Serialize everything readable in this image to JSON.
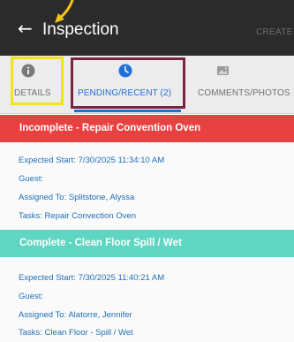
{
  "header": {
    "title": "Inspection",
    "create_label": "CREATE",
    "back_icon": "back-arrow-icon"
  },
  "tabs": [
    {
      "label": "DETAILS",
      "icon": "info-icon",
      "active": false
    },
    {
      "label": "PENDING/RECENT (2)",
      "icon": "clock-icon",
      "active": true
    },
    {
      "label": "COMMENTS/PHOTOS",
      "icon": "image-icon",
      "active": false
    }
  ],
  "tasks": [
    {
      "status_title": "Incomplete - Repair Convention Oven",
      "status_color": "#e84141",
      "expected_start": "Expected Start: 7/30/2025 11:34:10 AM",
      "guest": "Guest:",
      "assigned_to": "Assigned To: Splitstone, Alyssa",
      "tasks": "Tasks: Repair Convection Oven"
    },
    {
      "status_title": "Complete - Clean Floor Spill / Wet",
      "status_color": "#5ed6c1",
      "expected_start": "Expected Start: 7/30/2025 11:40:21 AM",
      "guest": "Guest:",
      "assigned_to": "Assigned To: Alatorre, Jennifer",
      "tasks": "Tasks: Clean Floor - Spill / Wet"
    }
  ],
  "annotations": {
    "pointer_color": "#f2c418",
    "highlight_details_color": "#f2e21a",
    "highlight_pending_color": "#7a2342"
  }
}
